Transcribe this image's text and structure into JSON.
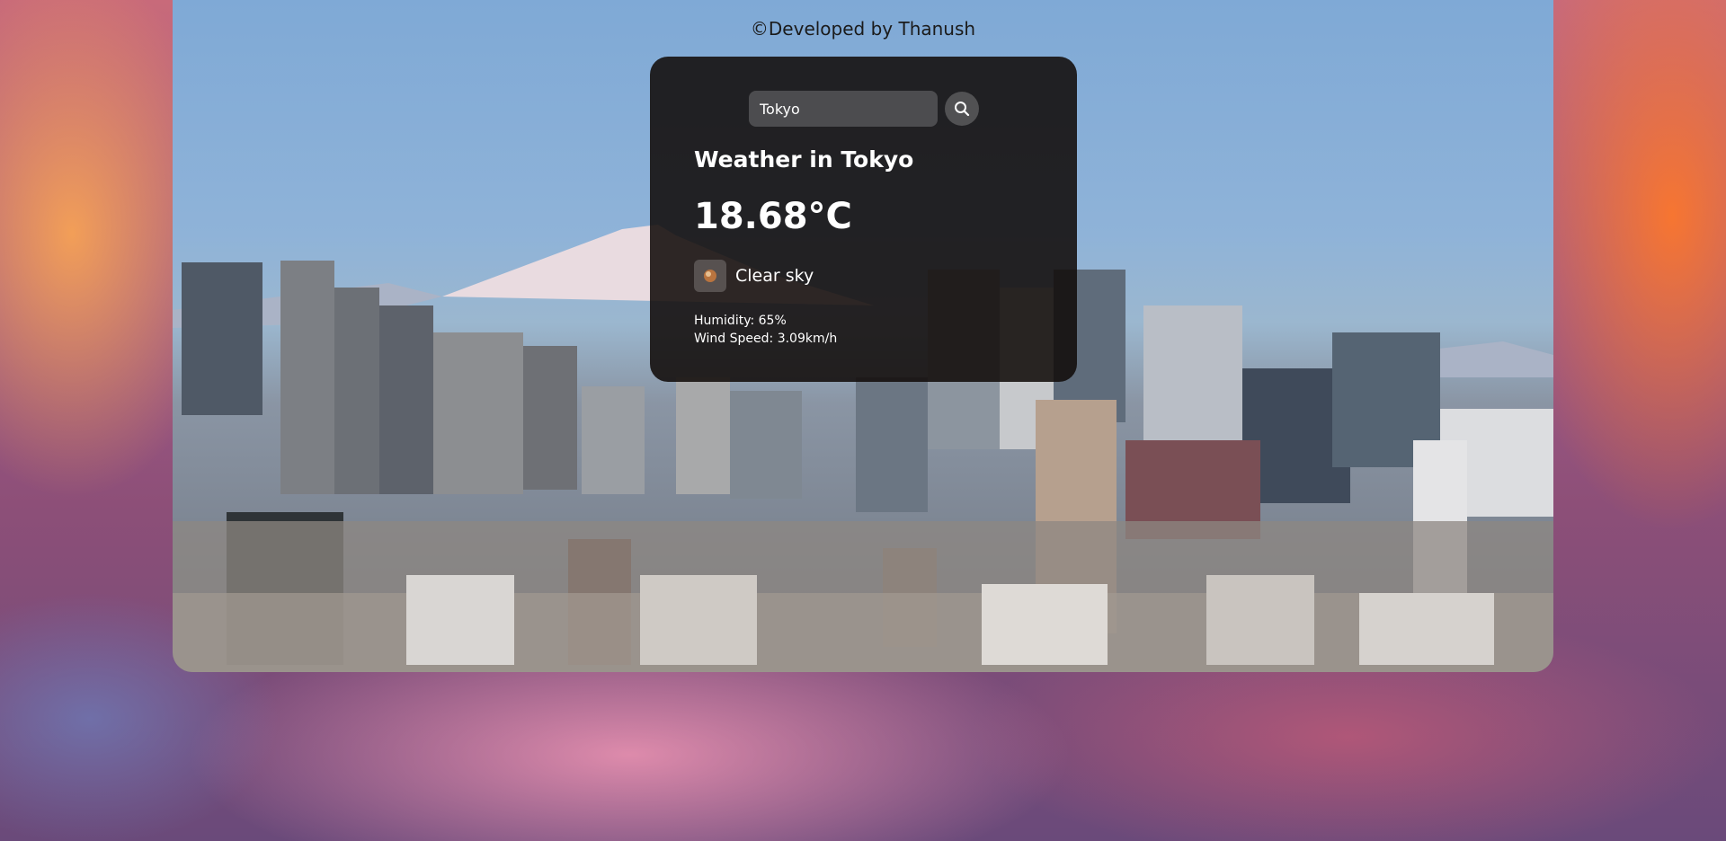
{
  "footer": {
    "credit": "©Developed by Thanush"
  },
  "search": {
    "value": "Tokyo",
    "button_icon": "search-icon"
  },
  "weather": {
    "title": "Weather in Tokyo",
    "temperature": "18.68°C",
    "condition_icon": "clear-sky-icon",
    "description": "Clear sky",
    "humidity": "Humidity: 65%",
    "wind": "Wind Speed: 3.09km/h"
  },
  "colors": {
    "card_background": "#120c0a",
    "text": "#ffffff",
    "credit_text": "#1b1b1b"
  }
}
